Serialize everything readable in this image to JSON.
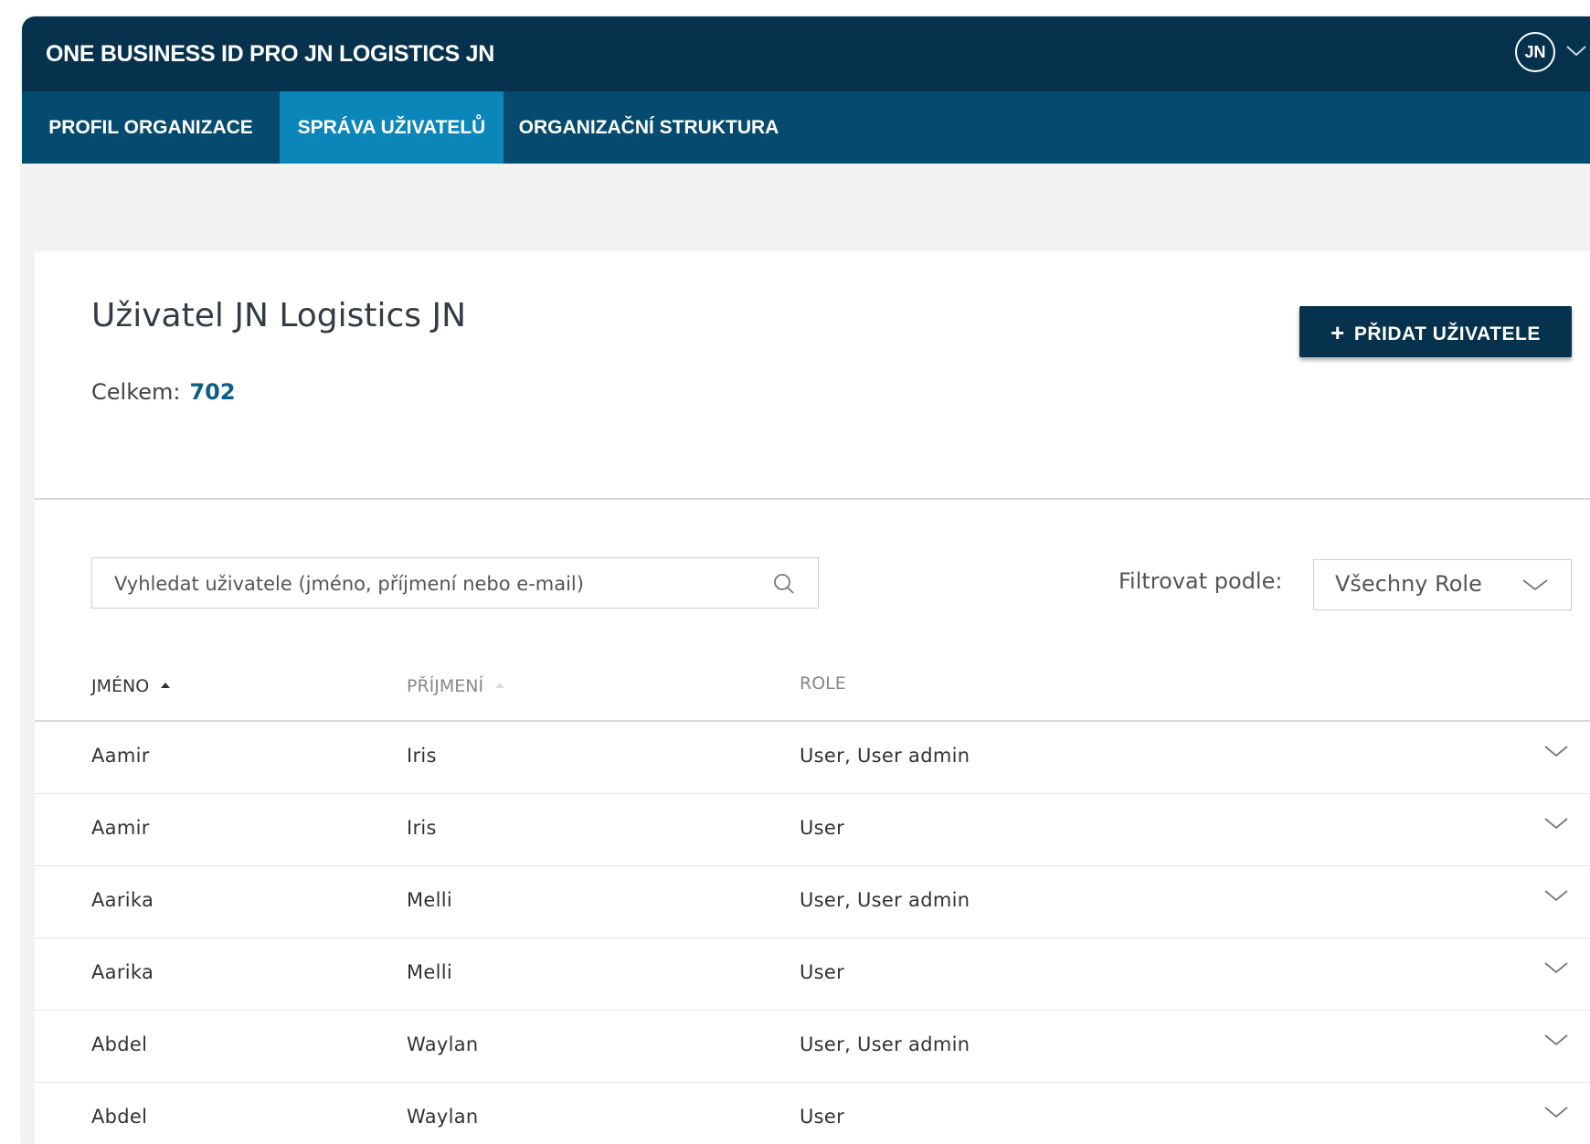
{
  "header": {
    "app_title": "ONE BUSINESS ID PRO JN LOGISTICS JN",
    "avatar_initials": "JN"
  },
  "nav": {
    "tabs": [
      {
        "label": "PROFIL ORGANIZACE",
        "active": false
      },
      {
        "label": "SPRÁVA UŽIVATELŮ",
        "active": true
      },
      {
        "label": "ORGANIZAČNÍ STRUKTURA",
        "active": false
      }
    ]
  },
  "main": {
    "title": "Uživatel JN Logistics JN",
    "total_label": "Celkem:",
    "total_value": "702",
    "add_button_label": "PŘIDAT UŽIVATELE",
    "search_placeholder": "Vyhledat uživatele (jméno, příjmení nebo e-mail)",
    "filter_label": "Filtrovat podle:",
    "filter_value": "Všechny Role"
  },
  "table": {
    "columns": [
      "JMÉNO",
      "PŘÍJMENÍ",
      "ROLE"
    ],
    "sorted_column": "JMÉNO",
    "rows": [
      {
        "first": "Aamir",
        "last": "Iris",
        "role": "User, User admin"
      },
      {
        "first": "Aamir",
        "last": "Iris",
        "role": "User"
      },
      {
        "first": "Aarika",
        "last": "Melli",
        "role": "User, User admin"
      },
      {
        "first": "Aarika",
        "last": "Melli",
        "role": "User"
      },
      {
        "first": "Abdel",
        "last": "Waylan",
        "role": "User, User admin"
      },
      {
        "first": "Abdel",
        "last": "Waylan",
        "role": "User"
      }
    ]
  },
  "colors": {
    "header_bg": "#06324d",
    "nav_bg": "#054a6f",
    "nav_active_bg": "#0a86b8",
    "accent_number": "#0b5f87"
  },
  "icons": {
    "avatar_menu": "chevron-down-icon",
    "search": "search-icon",
    "select": "chevron-down-icon",
    "row_expand": "chevron-down-icon",
    "sort": "sort-up-icon"
  }
}
